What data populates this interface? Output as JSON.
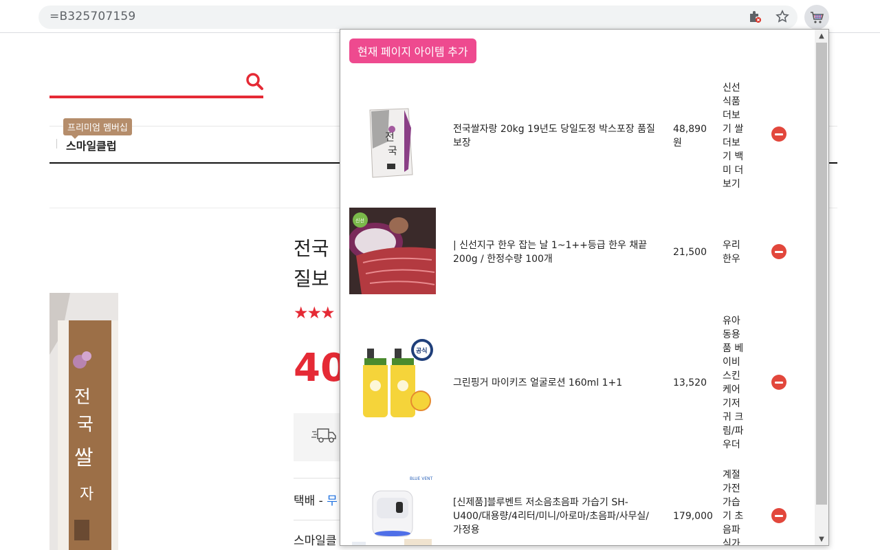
{
  "browser": {
    "url": "=B325707159"
  },
  "page": {
    "badge_label": "프리미엄 멤버십",
    "nav_smile_club": "스마일클럽",
    "title_line1": "전국",
    "title_line2": "질보",
    "stars": "★★★",
    "price_fragment": "40",
    "shipping_label": "택배 - ",
    "shipping_value": "무",
    "smile_label": "스마일클"
  },
  "popup": {
    "add_button_label": "현재 페이지 아이템 추가",
    "items": [
      {
        "name": "전국쌀자랑 20kg 19년도 당일도정 박스포장 품질보장",
        "price": "48,890원",
        "category": "신선식품 더보기 쌀 더보기 백미 더보기",
        "thumb": "rice-bag"
      },
      {
        "name": "| 신선지구 한우 잡는 날 1~1++등급 한우 채끝 200g / 한정수량 100개",
        "price": "21,500",
        "category": "우리한우",
        "thumb": "beef-steak"
      },
      {
        "name": "그린핑거 마이키즈 얼굴로션 160ml 1+1",
        "price": "13,520",
        "category": "유아동용품 베이비스킨케어 기저귀 크림/파우더",
        "thumb": "lotion-bottles"
      },
      {
        "name": "[신제품]블루벤트 저소음초음파 가습기 SH-U400/대용량/4리터/미니/아로마/초음파/사무실/가정용",
        "price": "179,000",
        "category": "계절가전 가습기 초음파 식가",
        "thumb": "humidifier"
      }
    ]
  },
  "colors": {
    "accent_pink": "#ee4a8f",
    "remove_red": "#e2473c",
    "brand_red": "#e52a35"
  }
}
